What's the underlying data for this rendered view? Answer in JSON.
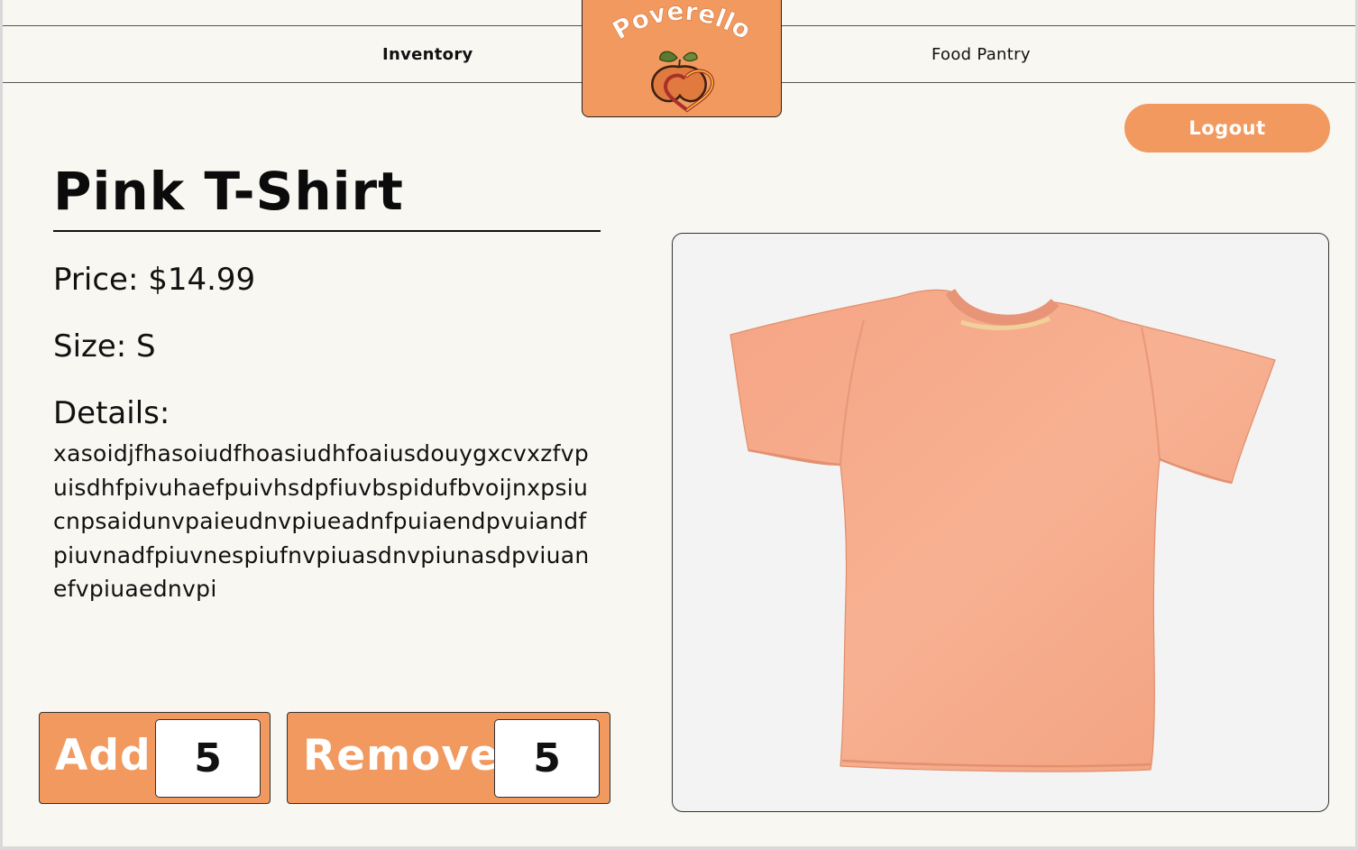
{
  "nav": {
    "inventory_label": "Inventory",
    "food_pantry_label": "Food Pantry"
  },
  "brand": {
    "name": "Poverello",
    "logo_icon": "peach-heart-icon"
  },
  "header": {
    "logout_label": "Logout"
  },
  "product": {
    "title": "Pink T-Shirt",
    "price_text": "Price: $14.99",
    "size_text": "Size: S",
    "details_heading": "Details:",
    "details_body": "xasoidjfhasoiudfhoasiudhfoaiusdouygxcvxzfvpuisdhfpivuhaefpuivhsdpfiuvbspidufbvoijnxpsiucnpsaidunvpaieudnvpiueadnfpuiaendpvuiandfpiuvnadfpiuvnespiufnvpiuasdnvpiunasdpviuanefvpiuaednvpi",
    "image_icon": "tshirt-photo"
  },
  "actions": {
    "add_label": "Add",
    "add_quantity": "5",
    "remove_label": "Remove",
    "remove_quantity": "5"
  },
  "colors": {
    "accent": "#f1995f",
    "background": "#f8f7f2",
    "shirt": "#f6ac8a",
    "panel": "#f3f3f3"
  }
}
